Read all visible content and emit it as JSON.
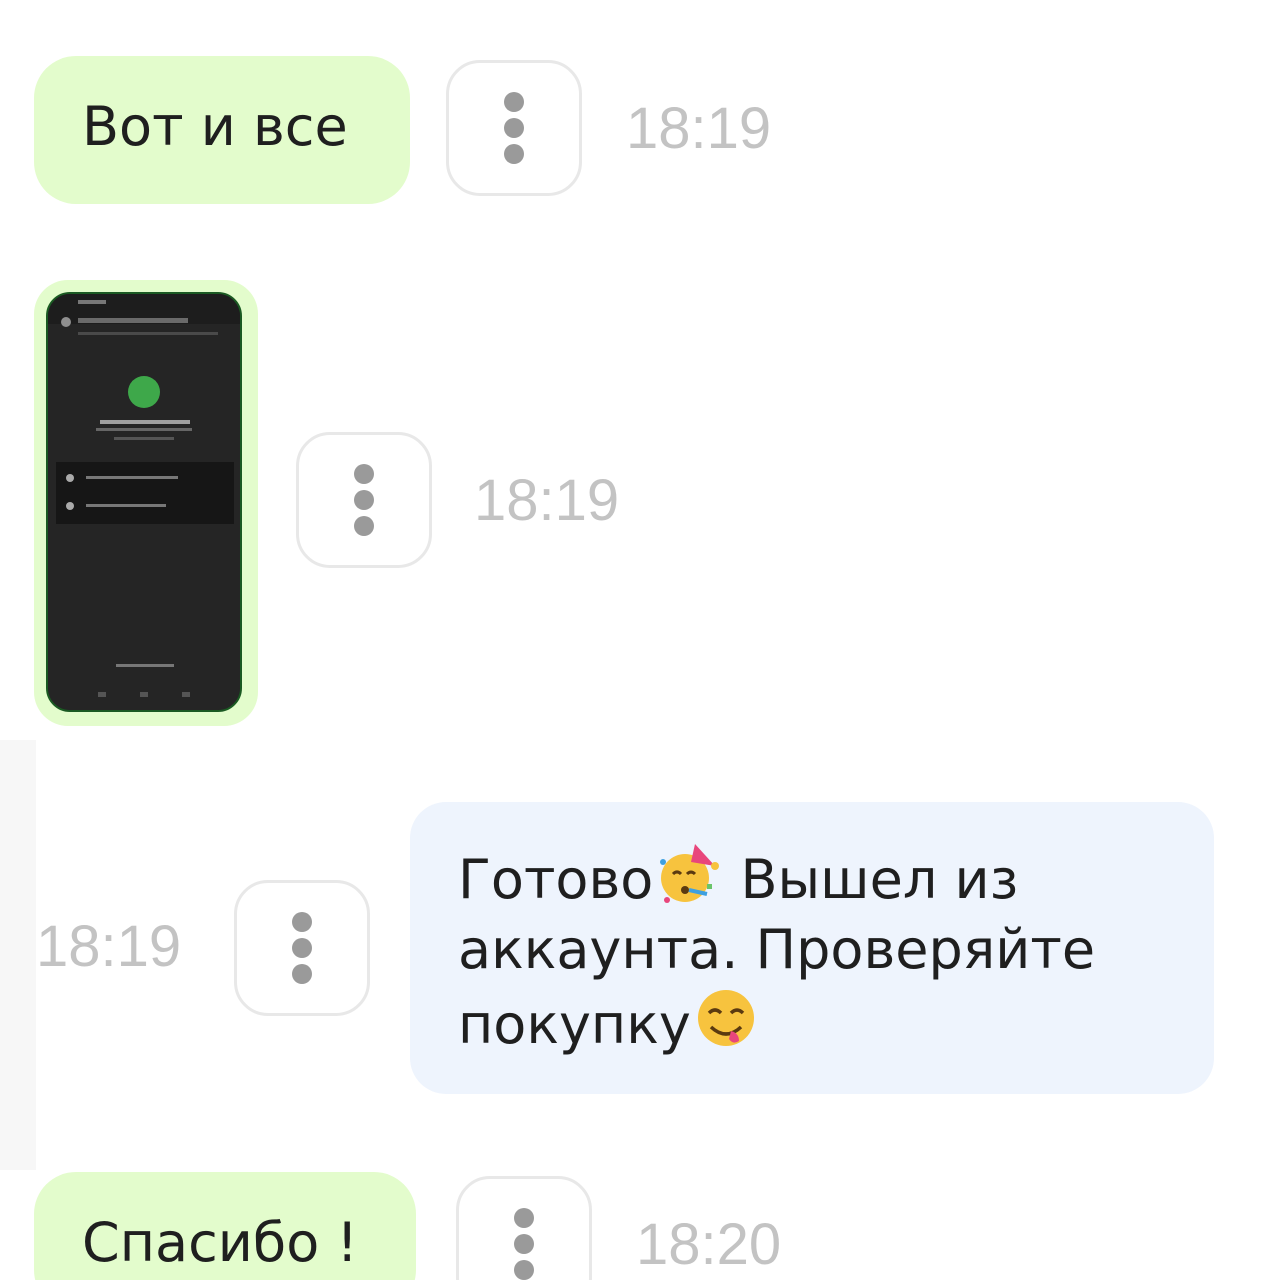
{
  "messages": [
    {
      "direction": "outgoing",
      "text": "Вот и все",
      "time": "18:19"
    },
    {
      "direction": "outgoing",
      "attachment": "screenshot-image",
      "time": "18:19"
    },
    {
      "direction": "incoming",
      "line1": "Готово",
      "line1b": "Вышел из",
      "line2": "аккаунта. Проверяйте",
      "line3": "покупку",
      "time": "18:19"
    },
    {
      "direction": "outgoing",
      "text": "Спасибо !",
      "time": "18:20"
    }
  ],
  "icons": {
    "more": "vertical-dots-icon",
    "party": "partying-face-emoji",
    "yum": "face-savoring-food-emoji"
  },
  "colors": {
    "outgoing_bubble": "#e3fccc",
    "incoming_bubble": "#eef4fd",
    "time_text": "#c3c3c3",
    "dots": "#9a9a9a"
  }
}
